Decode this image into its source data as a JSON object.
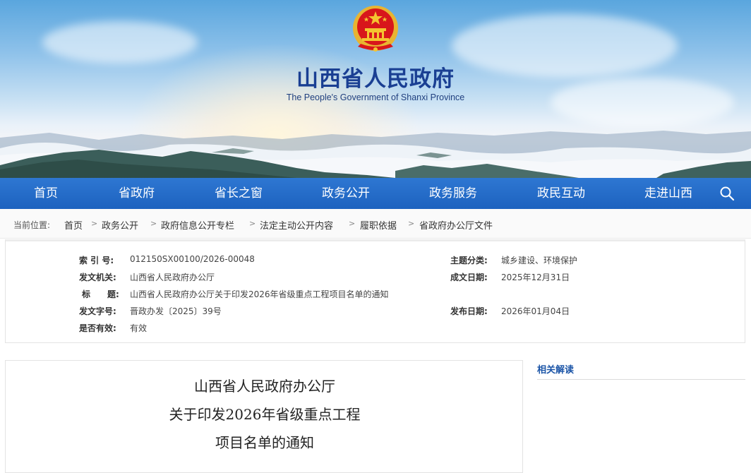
{
  "header": {
    "title": "山西省人民政府",
    "subtitle": "The People's Government of Shanxi Province",
    "emblem_icon": "national-emblem-icon"
  },
  "nav": {
    "items": [
      "首页",
      "省政府",
      "省长之窗",
      "政务公开",
      "政务服务",
      "政民互动",
      "走进山西"
    ],
    "search_icon": "search-icon"
  },
  "breadcrumb": {
    "label": "当前位置:",
    "items": [
      "首页",
      "政务公开",
      "政府信息公开专栏",
      "法定主动公开内容",
      "履职依据",
      "省政府办公厅文件"
    ]
  },
  "info": {
    "index_label": "索 引 号:",
    "index_value": "012150SX00100/2026-00048",
    "topic_label": "主题分类:",
    "topic_value": "城乡建设、环境保护",
    "issuer_label": "发文机关:",
    "issuer_value": "山西省人民政府办公厅",
    "written_label": "成文日期:",
    "written_value": "2025年12月31日",
    "title_label": "标　　题:",
    "title_value": "山西省人民政府办公厅关于印发2026年省级重点工程项目名单的通知",
    "docno_label": "发文字号:",
    "docno_value": "晋政办发〔2025〕39号",
    "published_label": "发布日期:",
    "published_value": "2026年01月04日",
    "valid_label": "是否有效:",
    "valid_value": "有效"
  },
  "document": {
    "lines": [
      "山西省人民政府办公厅",
      "关于印发2026年省级重点工程",
      "项目名单的通知"
    ]
  },
  "side": {
    "title": "相关解读"
  },
  "colors": {
    "nav_blue": "#2470cc",
    "title_blue": "#1a3f93",
    "link_blue": "#1d56a8",
    "emblem_red": "#d8161b",
    "emblem_gold": "#f4c430"
  }
}
